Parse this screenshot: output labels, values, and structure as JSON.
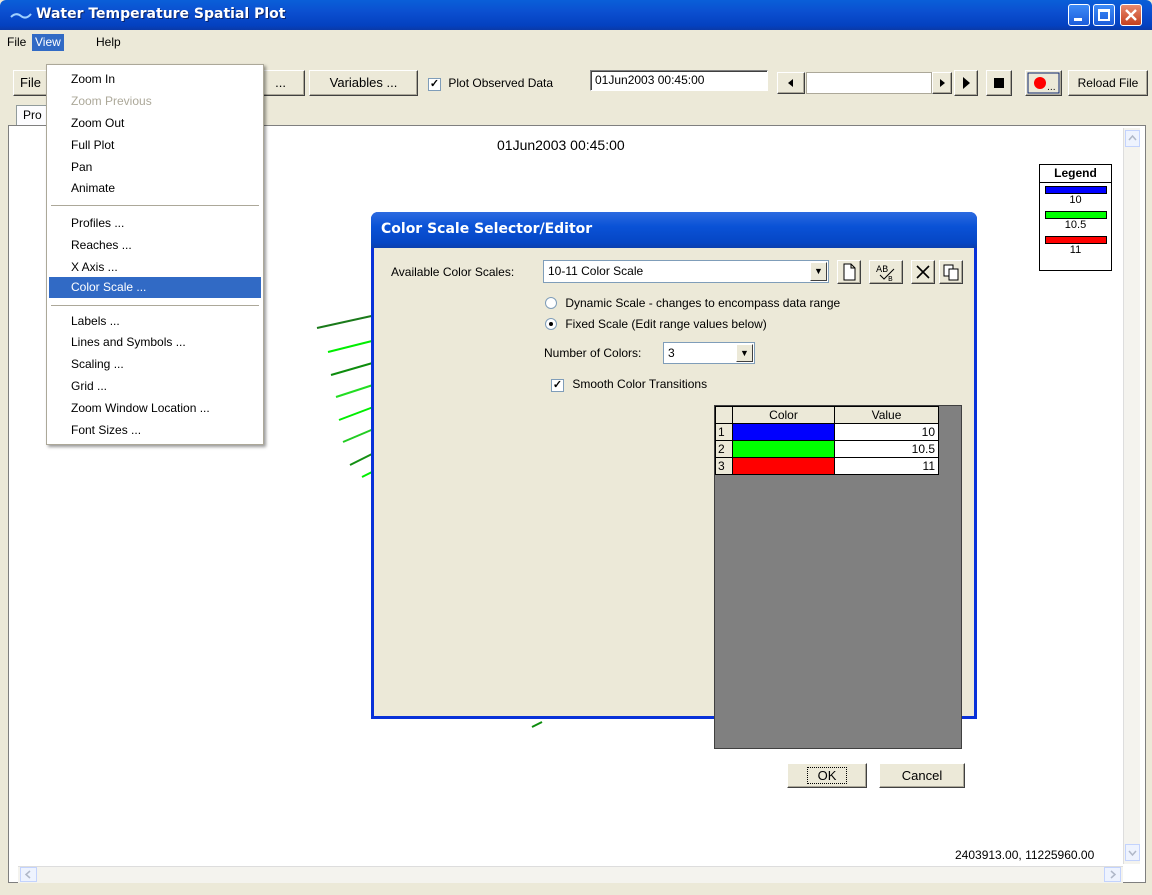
{
  "window": {
    "title": "Water Temperature Spatial Plot"
  },
  "menubar": {
    "file": "File",
    "view": "View",
    "help": "Help"
  },
  "toolbar": {
    "file_label": "File",
    "hidden_label": "...",
    "variables_label": "Variables ...",
    "plot_observed_label": "Plot Observed Data",
    "plot_observed_checked": true,
    "time_value": "01Jun2003 00:45:00",
    "reload_label": "Reload File"
  },
  "tabs": {
    "visible_fragment": "Pro"
  },
  "view_menu": {
    "items": [
      {
        "label": "Zoom In",
        "enabled": true
      },
      {
        "label": "Zoom Previous",
        "enabled": false
      },
      {
        "label": "Zoom Out",
        "enabled": true
      },
      {
        "label": "Full Plot",
        "enabled": true
      },
      {
        "label": "Pan",
        "enabled": true
      },
      {
        "label": "Animate",
        "enabled": true
      },
      {
        "label": "Profiles ...",
        "enabled": true
      },
      {
        "label": "Reaches ...",
        "enabled": true
      },
      {
        "label": "X Axis ...",
        "enabled": true
      },
      {
        "label": "Color Scale ...",
        "enabled": true,
        "selected": true
      },
      {
        "label": "Labels ...",
        "enabled": true
      },
      {
        "label": "Lines and Symbols ...",
        "enabled": true
      },
      {
        "label": "Scaling ...",
        "enabled": true
      },
      {
        "label": "Grid ...",
        "enabled": true
      },
      {
        "label": "Zoom Window Location ...",
        "enabled": true
      },
      {
        "label": "Font Sizes ...",
        "enabled": true
      }
    ]
  },
  "plot": {
    "title": "01Jun2003 00:45:00",
    "coordinates": "2403913.00, 11225960.00",
    "legend": {
      "title": "Legend",
      "entries": [
        {
          "value": "10",
          "color": "#0000ff"
        },
        {
          "value": "10.5",
          "color": "#00ff00"
        },
        {
          "value": "11",
          "color": "#ff0000"
        }
      ]
    }
  },
  "dialog": {
    "title": "Color Scale Selector/Editor",
    "available_label": "Available Color Scales:",
    "available_value": "10-11 Color Scale",
    "dynamic_label": "Dynamic Scale - changes to encompass data range",
    "fixed_label": "Fixed Scale  (Edit range values below)",
    "fixed_selected": true,
    "num_colors_label": "Number of Colors:",
    "num_colors_value": "3",
    "smooth_label": "Smooth Color Transitions",
    "smooth_checked": true,
    "table": {
      "headers": [
        "Color",
        "Value"
      ],
      "rows": [
        {
          "index": "1",
          "color": "#0000ff",
          "value": "10"
        },
        {
          "index": "2",
          "color": "#00ff00",
          "value": "10.5"
        },
        {
          "index": "3",
          "color": "#ff0000",
          "value": "11"
        }
      ]
    },
    "ok_label": "OK",
    "cancel_label": "Cancel"
  }
}
